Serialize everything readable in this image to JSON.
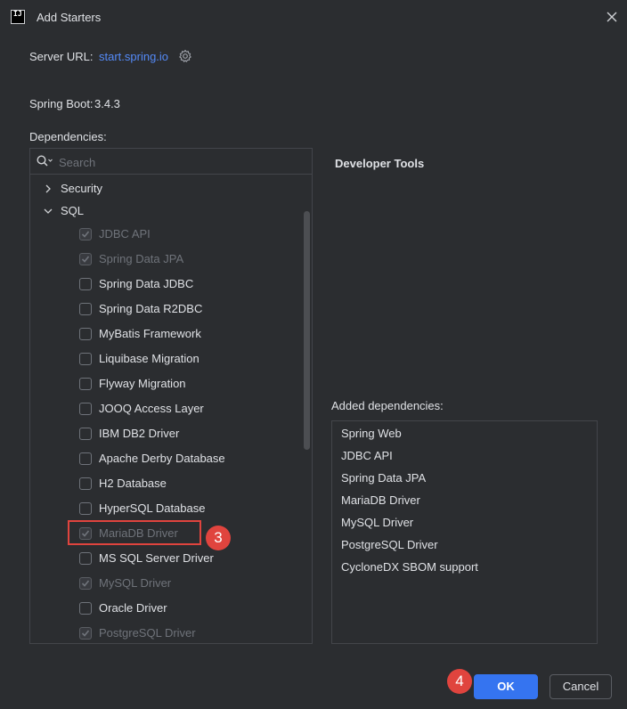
{
  "window": {
    "title": "Add Starters",
    "app_icon_text": "IJ"
  },
  "server": {
    "label": "Server URL:",
    "url": "start.spring.io"
  },
  "boot": {
    "label": "Spring Boot:",
    "version": "3.4.3"
  },
  "dependencies": {
    "label": "Dependencies:",
    "search_placeholder": "Search",
    "groups": [
      {
        "label": "Security",
        "expanded": false
      },
      {
        "label": "SQL",
        "expanded": true
      }
    ],
    "sql_items": [
      {
        "label": "JDBC API",
        "checked": true,
        "disabled": true
      },
      {
        "label": "Spring Data JPA",
        "checked": true,
        "disabled": true
      },
      {
        "label": "Spring Data JDBC",
        "checked": false,
        "disabled": false
      },
      {
        "label": "Spring Data R2DBC",
        "checked": false,
        "disabled": false
      },
      {
        "label": "MyBatis Framework",
        "checked": false,
        "disabled": false
      },
      {
        "label": "Liquibase Migration",
        "checked": false,
        "disabled": false
      },
      {
        "label": "Flyway Migration",
        "checked": false,
        "disabled": false
      },
      {
        "label": "JOOQ Access Layer",
        "checked": false,
        "disabled": false
      },
      {
        "label": "IBM DB2 Driver",
        "checked": false,
        "disabled": false
      },
      {
        "label": "Apache Derby Database",
        "checked": false,
        "disabled": false
      },
      {
        "label": "H2 Database",
        "checked": false,
        "disabled": false
      },
      {
        "label": "HyperSQL Database",
        "checked": false,
        "disabled": false
      },
      {
        "label": "MariaDB Driver",
        "checked": true,
        "disabled": true
      },
      {
        "label": "MS SQL Server Driver",
        "checked": false,
        "disabled": false
      },
      {
        "label": "MySQL Driver",
        "checked": true,
        "disabled": true
      },
      {
        "label": "Oracle Driver",
        "checked": false,
        "disabled": false
      },
      {
        "label": "PostgreSQL Driver",
        "checked": true,
        "disabled": true
      }
    ]
  },
  "detail": {
    "title": "Developer Tools"
  },
  "added": {
    "label": "Added dependencies:",
    "items": [
      "Spring Web",
      "JDBC API",
      "Spring Data JPA",
      "MariaDB Driver",
      "MySQL Driver",
      "PostgreSQL Driver",
      "CycloneDX SBOM support"
    ]
  },
  "annotations": {
    "step3": "3",
    "step4": "4"
  },
  "buttons": {
    "ok": "OK",
    "cancel": "Cancel"
  },
  "colors": {
    "accent": "#3574f0",
    "link": "#548af7",
    "annotation": "#e0443e",
    "background": "#2b2d30"
  }
}
